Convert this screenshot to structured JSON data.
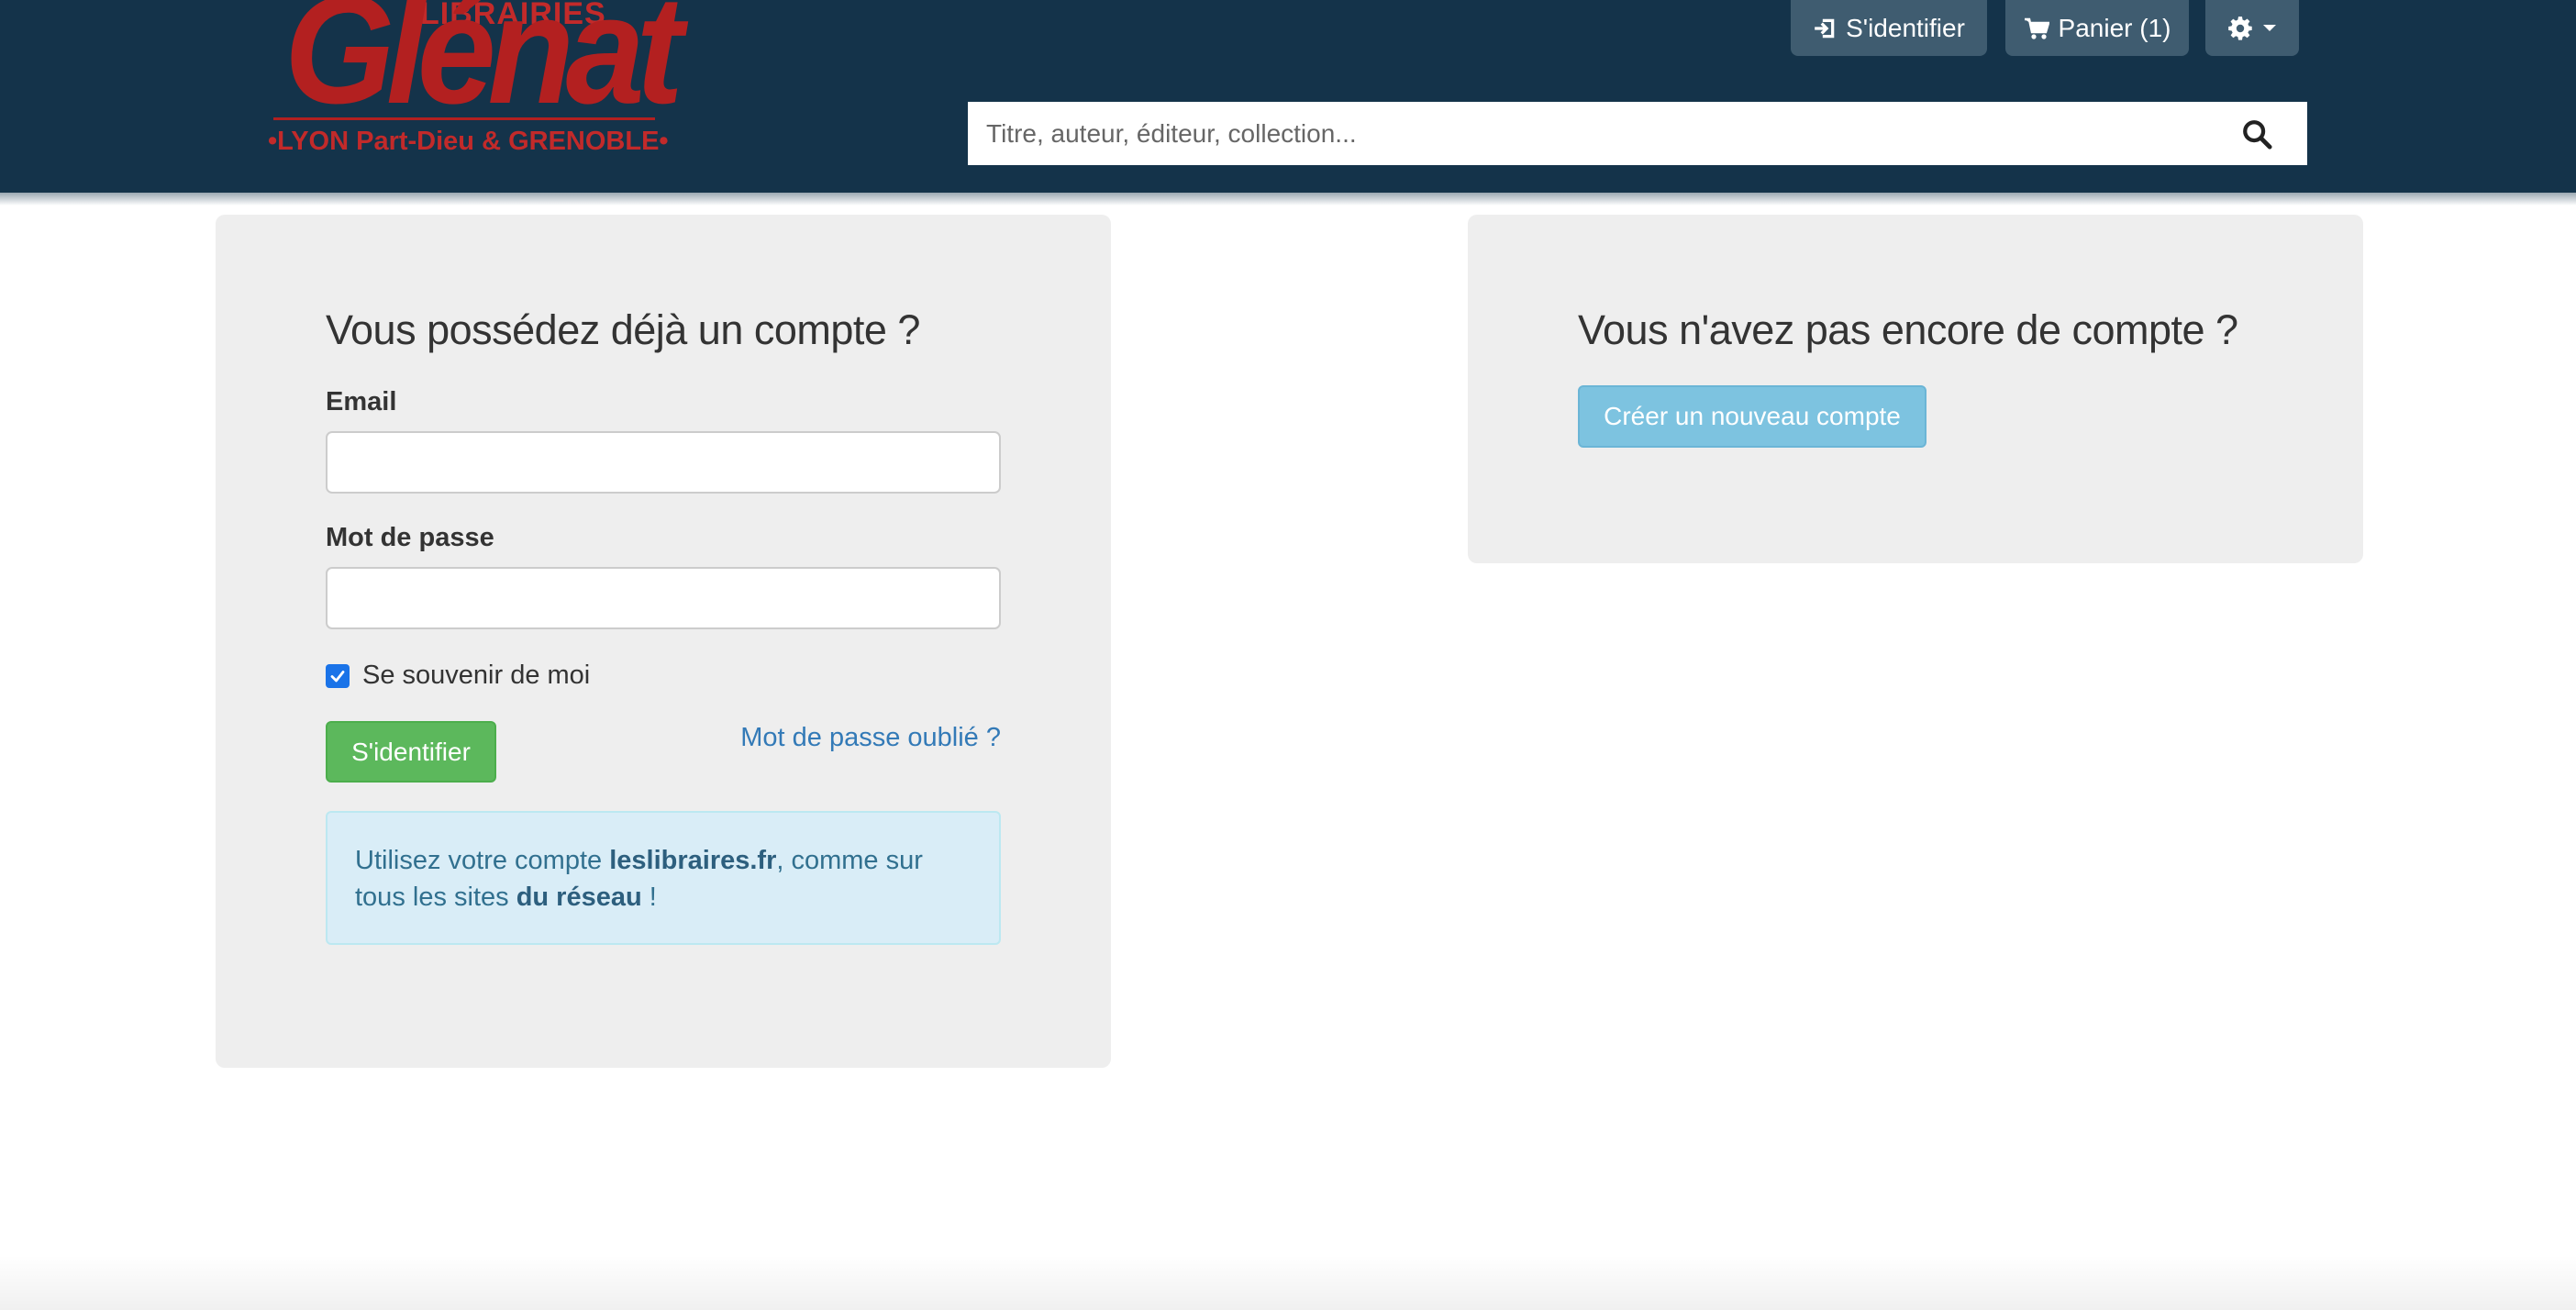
{
  "header": {
    "logo": {
      "top_word": "LIBRAIRIES",
      "brand": "Glénat",
      "subtitle": "•LYON Part-Dieu & GRENOBLE•"
    },
    "login_label": "S'identifier",
    "cart_label": "Panier (1)",
    "settings_icon": "gear-icon",
    "search": {
      "placeholder": "Titre, auteur, éditeur, collection...",
      "icon": "search-icon"
    },
    "colors": {
      "background": "#14334a",
      "buttons": "#3f5c70"
    }
  },
  "login_panel": {
    "title": "Vous possédez déjà un compte ?",
    "email_label": "Email",
    "email_value": "",
    "password_label": "Mot de passe",
    "password_value": "",
    "remember_label": "Se souvenir de moi",
    "remember_checked": true,
    "submit_label": "S'identifier",
    "forgot_label": "Mot de passe oublié ?",
    "info": {
      "part1": "Utilisez votre compte ",
      "site": "leslibraires.fr",
      "part2": ", comme sur tous les sites ",
      "network": "du réseau",
      "part3": " !"
    }
  },
  "register_panel": {
    "title": "Vous n'avez pas encore de compte ?",
    "create_label": "Créer un nouveau compte"
  }
}
